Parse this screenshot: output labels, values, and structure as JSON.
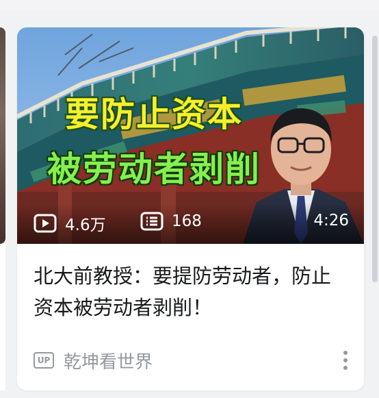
{
  "video_card": {
    "thumbnail": {
      "headline_line1": "要防止资本",
      "headline_line2": "被劳动者剥削",
      "views": "4.6万",
      "danmaku": "168",
      "duration": "4:26"
    },
    "title": "北大前教授：要提防劳动者，防止资本被劳动者剥削！",
    "up_badge": "UP",
    "author": "乾坤看世界"
  },
  "icons": {
    "views": "play-icon",
    "danmaku": "danmaku-icon",
    "more": "more-vertical-icon"
  },
  "colors": {
    "headline_yellow": "#f6ef2b",
    "headline_green": "#86ef4f",
    "text_primary": "#18191c",
    "text_secondary": "#9499a0"
  }
}
